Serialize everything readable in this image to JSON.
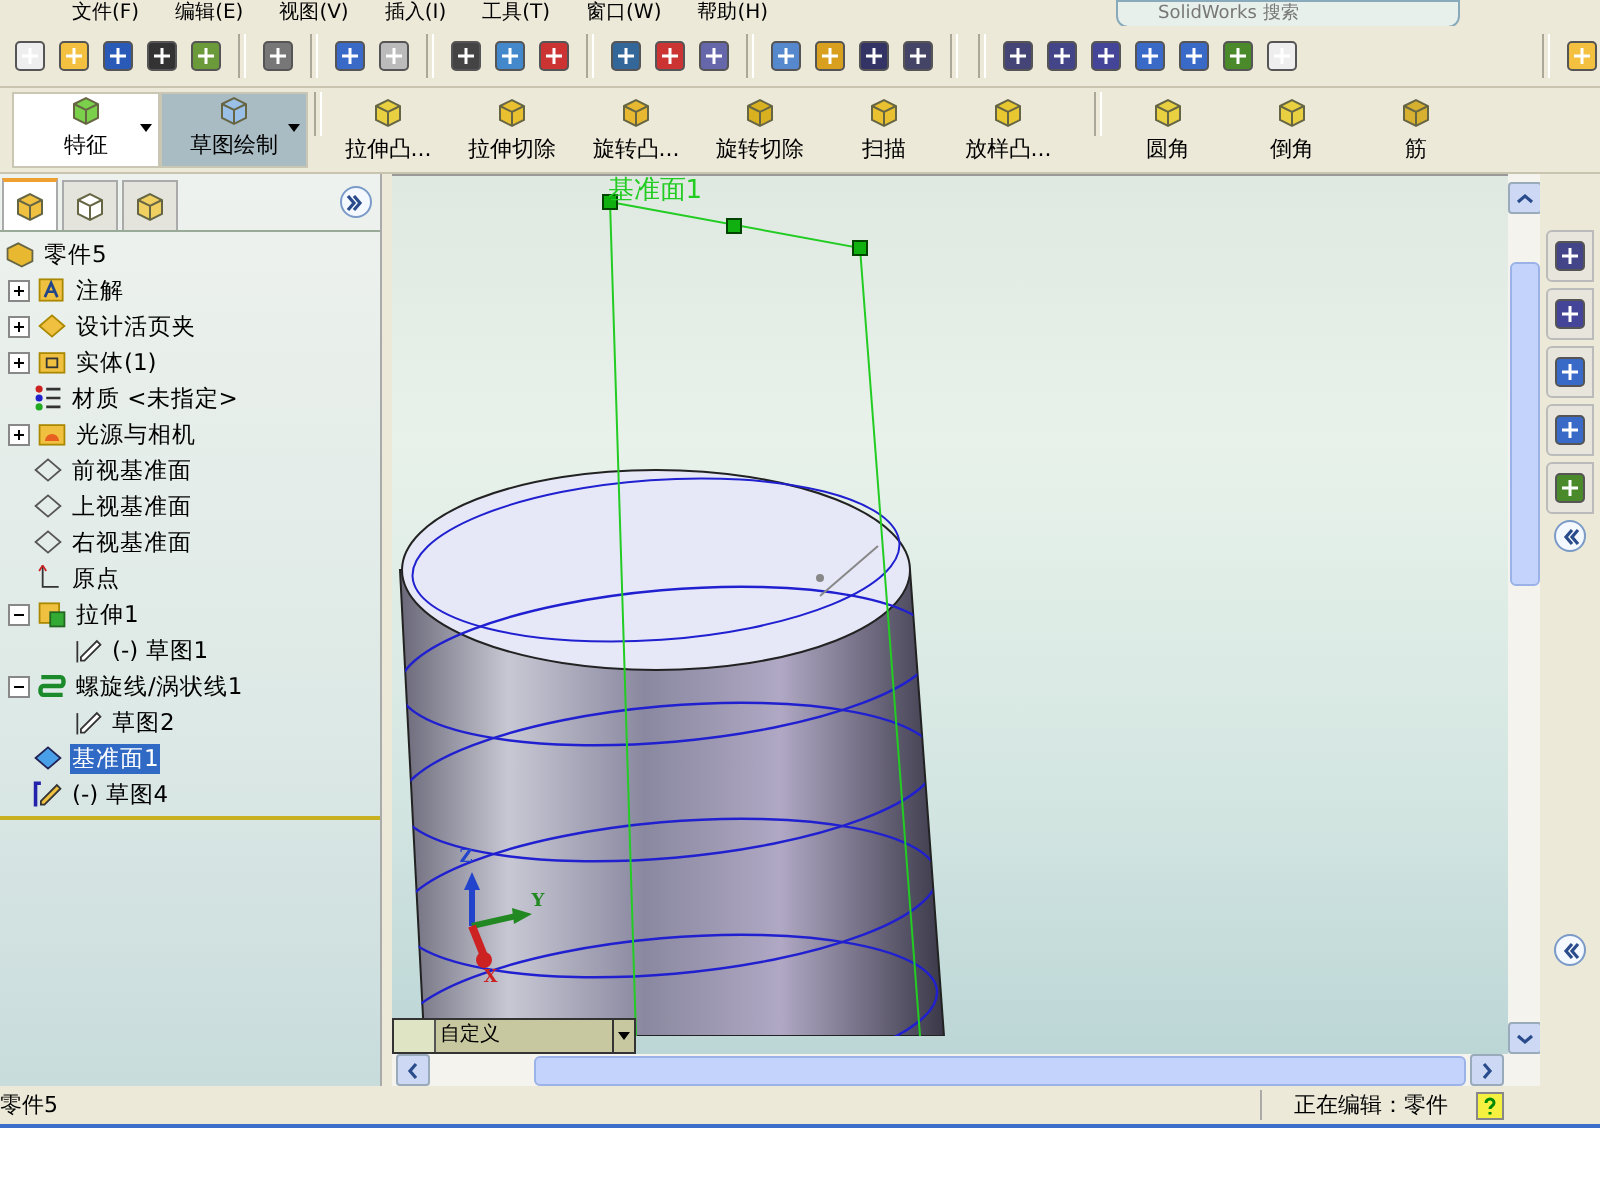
{
  "menu": [
    "文件(F)",
    "编辑(E)",
    "视图(V)",
    "插入(I)",
    "工具(T)",
    "窗口(W)",
    "帮助(H)"
  ],
  "search": {
    "placeholder": "SolidWorks 搜索"
  },
  "command_manager": {
    "tabs": [
      {
        "label": "特征",
        "selected": false
      },
      {
        "label": "草图绘制",
        "selected": true
      }
    ],
    "commands": [
      "拉伸凸...",
      "拉伸切除",
      "旋转凸...",
      "旋转切除",
      "扫描",
      "放样凸...",
      "圆角",
      "倒角",
      "筋"
    ]
  },
  "tree": {
    "root": "零件5",
    "items": [
      {
        "label": "注解",
        "kind": "annotation",
        "expanded": false,
        "selected": false
      },
      {
        "label": "设计活页夹",
        "kind": "binder",
        "expanded": false,
        "selected": false
      },
      {
        "label": "实体(1)",
        "kind": "solid",
        "expanded": false,
        "selected": false
      },
      {
        "label": "材质 <未指定>",
        "kind": "material",
        "selected": false
      },
      {
        "label": "光源与相机",
        "kind": "lights",
        "expanded": false,
        "selected": false
      },
      {
        "label": "前视基准面",
        "kind": "plane",
        "selected": false
      },
      {
        "label": "上视基准面",
        "kind": "plane",
        "selected": false
      },
      {
        "label": "右视基准面",
        "kind": "plane",
        "selected": false
      },
      {
        "label": "原点",
        "kind": "origin",
        "selected": false
      },
      {
        "label": "拉伸1",
        "kind": "extrude",
        "expanded": true,
        "selected": false,
        "children": [
          {
            "label": "(-) 草图1",
            "kind": "sketch",
            "selected": false
          }
        ]
      },
      {
        "label": "螺旋线/涡状线1",
        "kind": "helix",
        "expanded": true,
        "selected": false,
        "children": [
          {
            "label": "草图2",
            "kind": "sketch",
            "selected": false
          }
        ]
      },
      {
        "label": "基准面1",
        "kind": "plane-active",
        "selected": true
      },
      {
        "label": "(-) 草图4",
        "kind": "sketch-edit",
        "selected": false
      }
    ]
  },
  "viewport": {
    "plane_label": "基准面1",
    "triad": {
      "x": "X",
      "y": "Y",
      "z": "Z"
    },
    "view_dropdown": "自定义"
  },
  "status_bar": {
    "document": "零件5",
    "mode": "正在编辑：零件"
  }
}
